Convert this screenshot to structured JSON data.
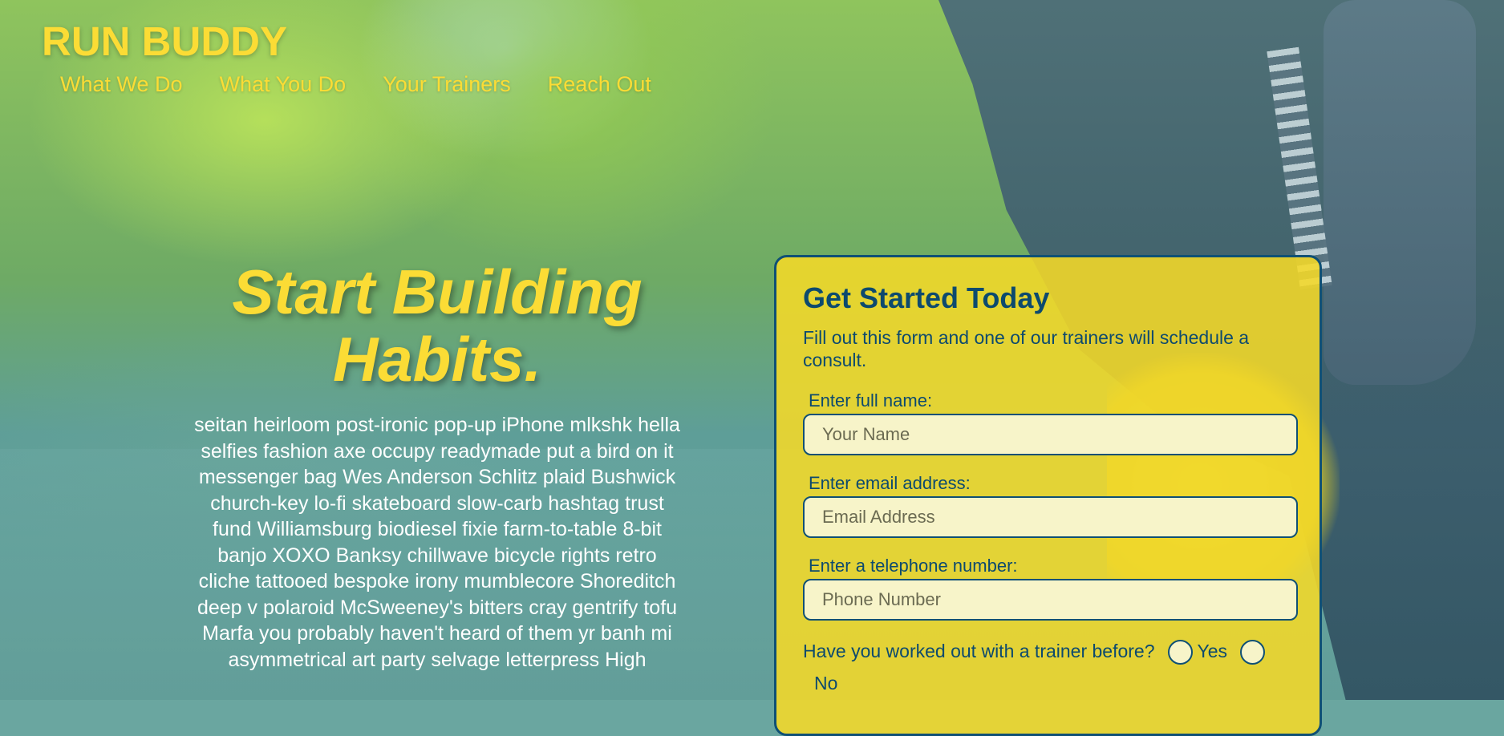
{
  "header": {
    "brand": "RUN BUDDY",
    "nav": [
      "What We Do",
      "What You Do",
      "Your Trainers",
      "Reach Out"
    ]
  },
  "hero": {
    "title_line1": "Start Building",
    "title_line2": "Habits.",
    "text": "seitan heirloom post-ironic pop-up iPhone mlkshk hella selfies fashion axe occupy readymade put a bird on it messenger bag Wes Anderson Schlitz plaid Bushwick church-key lo-fi skateboard slow-carb hashtag trust fund Williamsburg biodiesel fixie farm-to-table 8-bit banjo XOXO Banksy chillwave bicycle rights retro cliche tattooed bespoke irony mumblecore Shoreditch deep v polaroid McSweeney's bitters cray gentrify tofu Marfa you probably haven't heard of them yr banh mi asymmetrical art party selvage letterpress High"
  },
  "form": {
    "title": "Get Started Today",
    "subtitle": "Fill out this form and one of our trainers will schedule a consult.",
    "name_label": "Enter full name:",
    "name_placeholder": "Your Name",
    "email_label": "Enter email address:",
    "email_placeholder": "Email Address",
    "phone_label": "Enter a telephone number:",
    "phone_placeholder": "Phone Number",
    "trainer_question": "Have you worked out with a trainer before?",
    "yes_label": "Yes",
    "no_label": "No"
  },
  "colors": {
    "brand_yellow": "#fbdc35",
    "form_bg": "#f5da28",
    "form_text": "#0d4a6e"
  }
}
